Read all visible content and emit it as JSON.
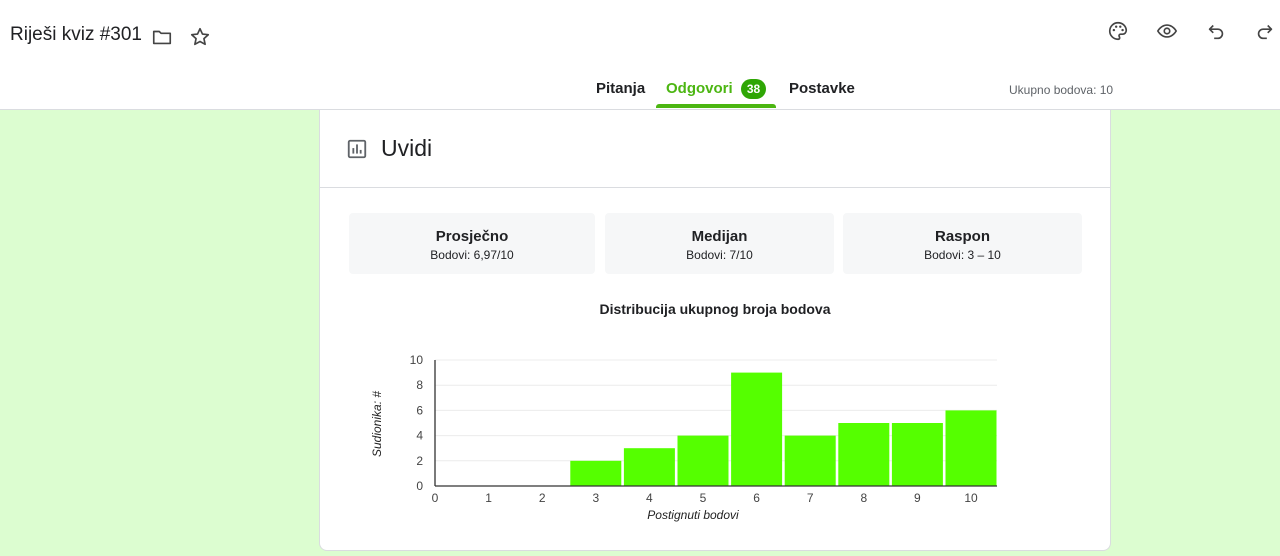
{
  "header": {
    "title": "Riješi kviz #301",
    "icons": [
      "folder-icon",
      "star-icon",
      "palette-icon",
      "eye-icon",
      "undo-icon",
      "redo-icon"
    ]
  },
  "tabs": {
    "questions": "Pitanja",
    "responses": "Odgovori",
    "responses_count": "38",
    "settings": "Postavke",
    "active": "responses",
    "total_points": "Ukupno bodova: 10"
  },
  "insights": {
    "title": "Uvidi",
    "stats": {
      "average": {
        "label": "Prosječno",
        "value": "Bodovi: 6,97/10"
      },
      "median": {
        "label": "Medijan",
        "value": "Bodovi: 7/10"
      },
      "range": {
        "label": "Raspon",
        "value": "Bodovi: 3 – 10"
      }
    }
  },
  "colors": {
    "accent": "#4cb612",
    "badge": "#2fa605",
    "bar": "#55ff00",
    "background": "#dcfdd0"
  },
  "chart_data": {
    "type": "bar",
    "title": "Distribucija ukupnog broja bodova",
    "xlabel": "Postignuti bodovi",
    "ylabel": "Sudionika: #",
    "categories": [
      "0",
      "1",
      "2",
      "3",
      "4",
      "5",
      "6",
      "7",
      "8",
      "9",
      "10"
    ],
    "values": [
      0,
      0,
      0,
      2,
      3,
      4,
      9,
      4,
      5,
      5,
      6
    ],
    "ylim": [
      0,
      10
    ],
    "yticks": [
      "0",
      "2",
      "4",
      "6",
      "8",
      "10"
    ],
    "grid": true
  }
}
